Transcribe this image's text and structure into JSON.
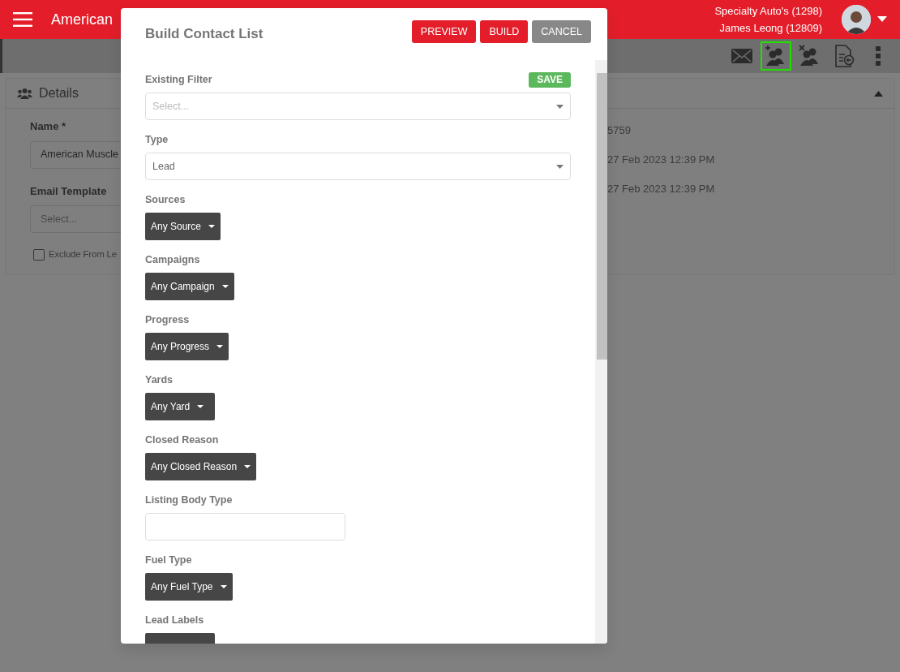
{
  "navbar": {
    "title": "American",
    "account_lines": [
      "Specialty Auto's (1298)",
      "James Leong (12809)"
    ]
  },
  "toolbar": {
    "icons": [
      {
        "kind": "mail",
        "selected": false
      },
      {
        "kind": "add-contacts",
        "selected": true
      },
      {
        "kind": "remove-contacts",
        "selected": false
      },
      {
        "kind": "document",
        "selected": false
      },
      {
        "kind": "more",
        "selected": false
      }
    ]
  },
  "details": {
    "title": "Details",
    "fields": [
      {
        "label": "Name *",
        "value": "American Muscle"
      },
      {
        "label": "Email Template",
        "placeholder": "Select..."
      }
    ],
    "checkbox": {
      "label": "Exclude From Le",
      "checked": false
    },
    "values": [
      "5759",
      "27 Feb 2023 12:39 PM",
      "27 Feb 2023 12:39 PM"
    ]
  },
  "modal": {
    "title": "Build Contact List",
    "buttons": [
      {
        "label": "PREVIEW",
        "kind": "primary"
      },
      {
        "label": "BUILD",
        "kind": "primary"
      },
      {
        "label": "CANCEL",
        "kind": "secondary"
      }
    ],
    "filters": [
      {
        "label": "Existing Filter",
        "kind": "select",
        "placeholder": "Select...",
        "action": "SAVE"
      },
      {
        "label": "Type",
        "kind": "select",
        "value": "Lead"
      },
      {
        "label": "Sources",
        "kind": "dropdown",
        "value": "Any Source"
      },
      {
        "label": "Campaigns",
        "kind": "dropdown",
        "value": "Any Campaign"
      },
      {
        "label": "Progress",
        "kind": "dropdown",
        "value": "Any Progress"
      },
      {
        "label": "Yards",
        "kind": "dropdown",
        "value": "Any Yard"
      },
      {
        "label": "Closed Reason",
        "kind": "dropdown",
        "value": "Any Closed Reason"
      },
      {
        "label": "Listing Body Type",
        "kind": "text"
      },
      {
        "label": "Fuel Type",
        "kind": "dropdown",
        "value": "Any Fuel Type"
      },
      {
        "label": "Lead Labels",
        "kind": "dropdown"
      }
    ]
  }
}
